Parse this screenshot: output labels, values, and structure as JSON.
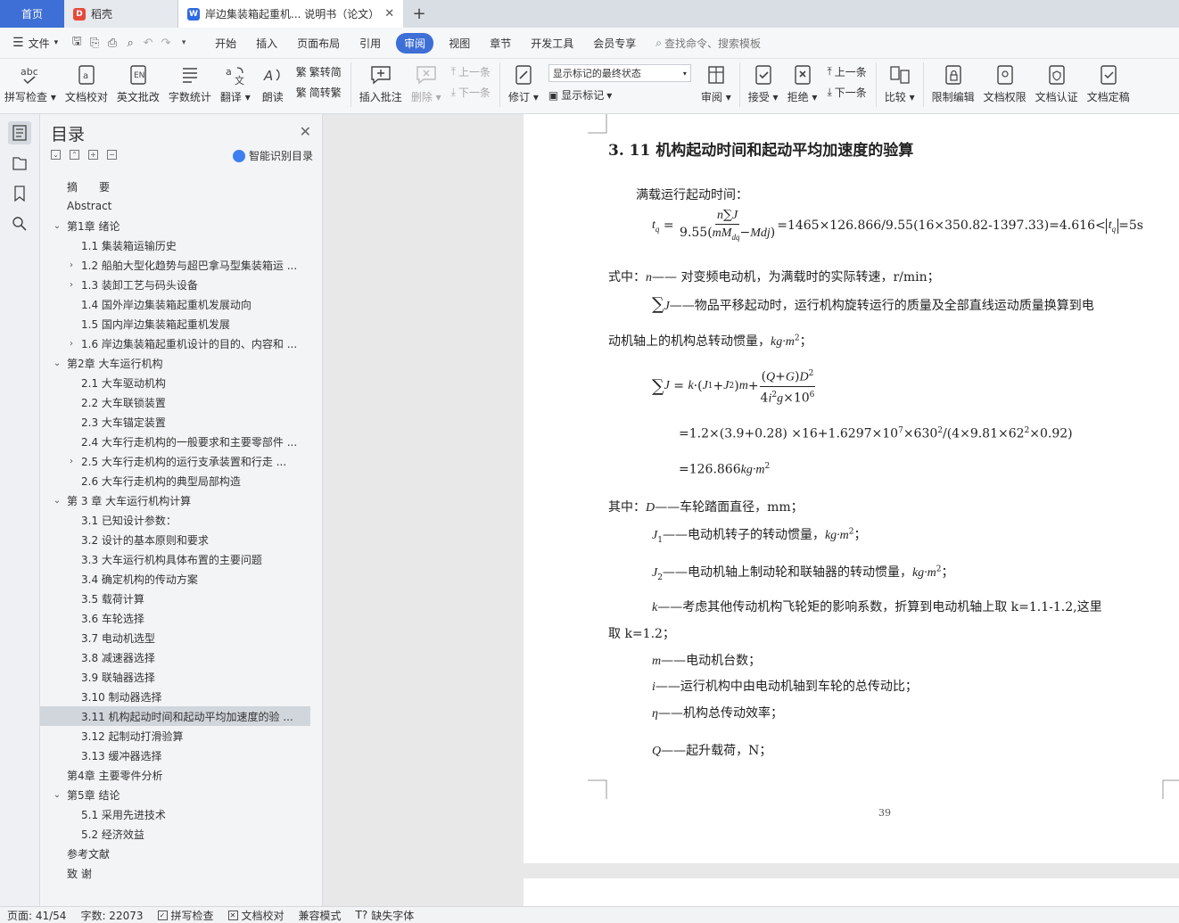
{
  "tabs": {
    "home": "首页",
    "daoke": "稻壳",
    "doc": "岸边集装箱起重机... 说明书（论文）"
  },
  "menu": {
    "file": "文件",
    "items": [
      "开始",
      "插入",
      "页面布局",
      "引用",
      "审阅",
      "视图",
      "章节",
      "开发工具",
      "会员专享"
    ],
    "active": "审阅",
    "search": "查找命令、搜索模板"
  },
  "ribbon": {
    "spell": "拼写检查",
    "proof": "文档校对",
    "en_review": "英文批改",
    "word_count": "字数统计",
    "translate": "翻译",
    "read_aloud": "朗读",
    "to_trad": "繁转简",
    "to_simp": "简转繁",
    "insert_comment": "插入批注",
    "delete": "删除",
    "prev": "上一条",
    "next": "下一条",
    "revise": "修订",
    "markup_state": "显示标记的最终状态",
    "show_markup": "显示标记",
    "review": "审阅",
    "accept": "接受",
    "reject": "拒绝",
    "prev2": "上一条",
    "next2": "下一条",
    "compare": "比较",
    "restrict": "限制编辑",
    "permission": "文档权限",
    "certify": "文档认证",
    "finalize": "文档定稿"
  },
  "toc": {
    "title": "目录",
    "smart": "智能识别目录",
    "items": [
      {
        "text": "摘　　要",
        "level": 1,
        "arrow": ""
      },
      {
        "text": "Abstract",
        "level": 1,
        "arrow": ""
      },
      {
        "text": "第1章  绪论",
        "level": 1,
        "arrow": "v"
      },
      {
        "text": "1.1    集装箱运输历史",
        "level": 2,
        "arrow": ""
      },
      {
        "text": "1.2    船舶大型化趋势与超巴拿马型集装箱运 ...",
        "level": 2,
        "arrow": ">"
      },
      {
        "text": "1.3      装卸工艺与码头设备",
        "level": 2,
        "arrow": ">"
      },
      {
        "text": "1.4    国外岸边集装箱起重机发展动向",
        "level": 2,
        "arrow": ""
      },
      {
        "text": "1.5    国内岸边集装箱起重机发展",
        "level": 2,
        "arrow": ""
      },
      {
        "text": "1.6    岸边集装箱起重机设计的目的、内容和 ...",
        "level": 2,
        "arrow": ">"
      },
      {
        "text": "第2章  大车运行机构",
        "level": 1,
        "arrow": "v"
      },
      {
        "text": "2.1    大车驱动机构",
        "level": 2,
        "arrow": ""
      },
      {
        "text": "2.2  大车联锁装置",
        "level": 2,
        "arrow": ""
      },
      {
        "text": "2.3      大车锚定装置",
        "level": 2,
        "arrow": ""
      },
      {
        "text": "2.4  大车行走机构的一般要求和主要零部件 ...",
        "level": 2,
        "arrow": ""
      },
      {
        "text": "2.5      大车行走机构的运行支承装置和行走 ...",
        "level": 2,
        "arrow": ">"
      },
      {
        "text": "2.6  大车行走机构的典型局部构造",
        "level": 2,
        "arrow": ""
      },
      {
        "text": "第 3 章     大车运行机构计算",
        "level": 1,
        "arrow": "v"
      },
      {
        "text": "3.1    已知设计参数：",
        "level": 2,
        "arrow": ""
      },
      {
        "text": "3.2    设计的基本原则和要求",
        "level": 2,
        "arrow": ""
      },
      {
        "text": "3.3      大车运行机构具体布置的主要问题",
        "level": 2,
        "arrow": ""
      },
      {
        "text": "3.4      确定机构的传动方案",
        "level": 2,
        "arrow": ""
      },
      {
        "text": "3.5    载荷计算",
        "level": 2,
        "arrow": ""
      },
      {
        "text": "3.6    车轮选择",
        "level": 2,
        "arrow": ""
      },
      {
        "text": "3.7    电动机选型",
        "level": 2,
        "arrow": ""
      },
      {
        "text": "3.8  减速器选择",
        "level": 2,
        "arrow": ""
      },
      {
        "text": "3.9    联轴器选择",
        "level": 2,
        "arrow": ""
      },
      {
        "text": "3.10    制动器选择",
        "level": 2,
        "arrow": ""
      },
      {
        "text": "3.11    机构起动时间和起动平均加速度的验 ...",
        "level": 2,
        "arrow": "",
        "selected": true
      },
      {
        "text": "3.12    起制动打滑验算",
        "level": 2,
        "arrow": ""
      },
      {
        "text": "3.13    缓冲器选择",
        "level": 2,
        "arrow": ""
      },
      {
        "text": "第4章  主要零件分析",
        "level": 1,
        "arrow": ""
      },
      {
        "text": "第5章  结论",
        "level": 1,
        "arrow": "v"
      },
      {
        "text": "5.1  采用先进技术",
        "level": 2,
        "arrow": ""
      },
      {
        "text": "5.2  经济效益",
        "level": 2,
        "arrow": ""
      },
      {
        "text": "参考文献",
        "level": 1,
        "arrow": ""
      },
      {
        "text": "致  谢",
        "level": 1,
        "arrow": ""
      }
    ]
  },
  "page": {
    "heading": "3. 11   机构起动时间和起动平均加速度的验算",
    "line1": "满载运行起动时间：",
    "formula1_result": "=1465×126.866/9.55(16×350.82-1397.33)=4.616<",
    "formula1_tail": "=5s",
    "shizhong": "式中：",
    "n_desc": "—— 对变频电动机，为满载时的实际转速，r/min；",
    "sumj_desc": "——物品平移起动时，运行机构旋转运行的质量及全部直线运动质量换算到电",
    "sumj_desc2": "动机轴上的机构总转动惯量，",
    "formula2_l1": "=1.2×(3.9+0.28)  ×16+1.6297×10",
    "formula2_l1b": "×630",
    "formula2_l1c": "/(4×9.81×62",
    "formula2_l1d": "×0.92)",
    "formula2_l2": "=126.866",
    "qizhong": "其中：",
    "d_desc": "——车轮踏面直径，mm；",
    "j1_desc": "——电动机转子的转动惯量，",
    "j2_desc": "——电动机轴上制动轮和联轴器的转动惯量，",
    "k_desc": "——考虑其他传动机构飞轮矩的影响系数，折算到电动机轴上取 k=1.1-1.2,这里",
    "k_desc2": "取 k=1.2；",
    "m_desc": "——电动机台数；",
    "i_desc": "——运行机构中由电动机轴到车轮的总传动比；",
    "eta_desc": "——机构总传动效率；",
    "q_desc": "——起升载荷，N；",
    "page_num": "39"
  },
  "status": {
    "page": "页面: 41/54",
    "words": "字数: 22073",
    "spell": "拼写检查",
    "proof": "文档校对",
    "compat": "兼容模式",
    "font": "缺失字体"
  },
  "chart_data": {
    "type": "table",
    "title": "3. 11   机构起动时间和起动平均加速度的验算",
    "values": [
      1465,
      126.866,
      9.55,
      16,
      350.82,
      1397.33,
      4.616,
      5,
      1.2,
      3.9,
      0.28,
      1.6297,
      630,
      9.81,
      62,
      0.92
    ]
  }
}
